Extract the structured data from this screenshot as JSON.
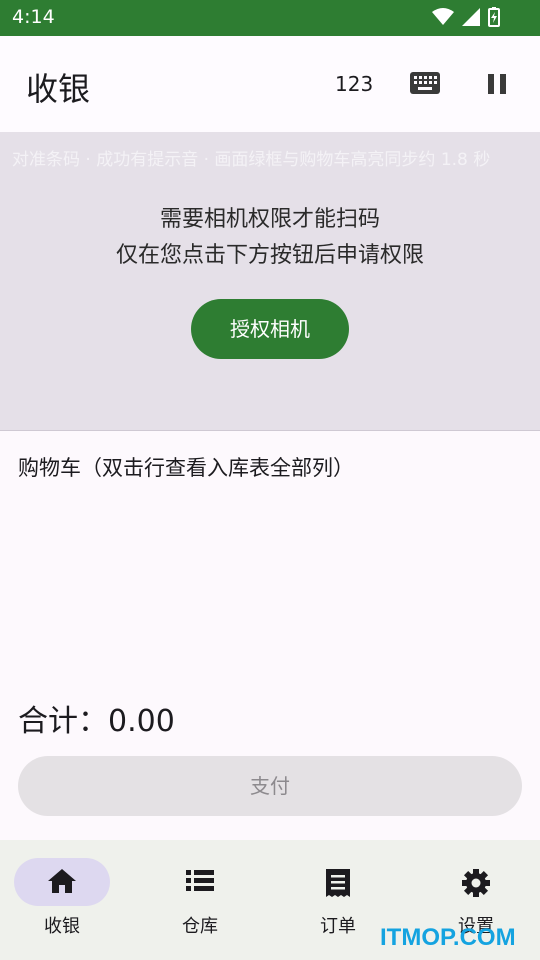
{
  "status_bar": {
    "time": "4:14"
  },
  "app_bar": {
    "title": "收银",
    "input_mode": "123"
  },
  "scanner": {
    "hint": "对准条码 · 成功有提示音 · 画面绿框与购物车高亮同步约 1.8 秒",
    "message_line1": "需要相机权限才能扫码",
    "message_line2": "仅在您点击下方按钮后申请权限",
    "grant_button": "授权相机"
  },
  "cart": {
    "title": "购物车（双击行查看入库表全部列）",
    "total_label": "合计：",
    "total_value": "0.00",
    "pay_button": "支付"
  },
  "bottom_nav": {
    "items": [
      {
        "label": "收银",
        "icon": "home-icon",
        "selected": true
      },
      {
        "label": "仓库",
        "icon": "list-icon",
        "selected": false
      },
      {
        "label": "订单",
        "icon": "receipt-icon",
        "selected": false
      },
      {
        "label": "设置",
        "icon": "gear-icon",
        "selected": false
      }
    ]
  },
  "watermark": "ITMOP.COM",
  "colors": {
    "primary": "#2e7d32",
    "scanner_bg": "#e5e0e8",
    "nav_selected": "#ddd8f0"
  }
}
